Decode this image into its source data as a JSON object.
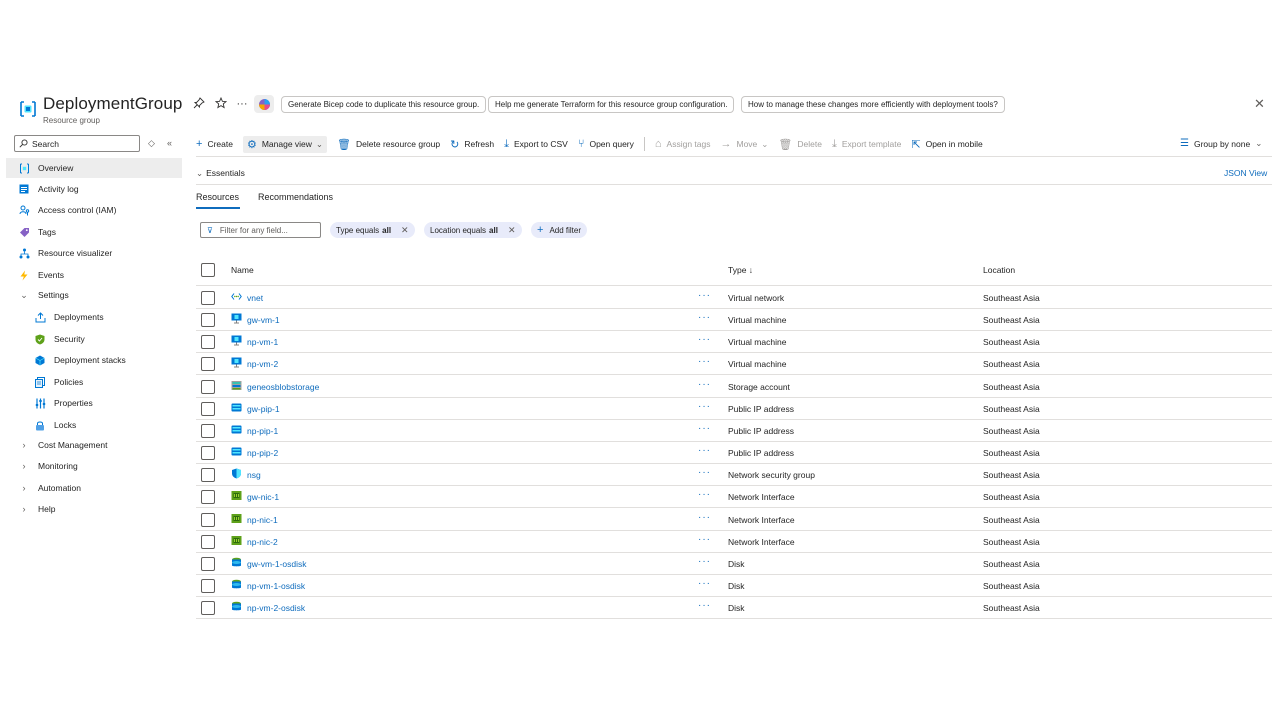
{
  "header": {
    "title": "DeploymentGroup",
    "subtitle": "Resource group",
    "suggestions": [
      "Generate Bicep code to duplicate this resource group.",
      "Help me generate Terraform for this resource group configuration.",
      "How to manage these changes more efficiently with deployment tools?"
    ],
    "close_glyph": "✕"
  },
  "sidebar": {
    "search_placeholder": "Search",
    "items": [
      {
        "label": "Overview",
        "icon": "resource-group-icon",
        "active": true
      },
      {
        "label": "Activity log",
        "icon": "activity-log-icon"
      },
      {
        "label": "Access control (IAM)",
        "icon": "iam-icon"
      },
      {
        "label": "Tags",
        "icon": "tag-icon"
      },
      {
        "label": "Resource visualizer",
        "icon": "visualizer-icon"
      },
      {
        "label": "Events",
        "icon": "lightning-icon"
      },
      {
        "label": "Settings",
        "icon": "chevron-down-icon",
        "expanded": true
      },
      {
        "label": "Deployments",
        "icon": "deployments-icon",
        "sub": true
      },
      {
        "label": "Security",
        "icon": "shield-icon",
        "sub": true
      },
      {
        "label": "Deployment stacks",
        "icon": "stack-icon",
        "sub": true
      },
      {
        "label": "Policies",
        "icon": "policy-icon",
        "sub": true
      },
      {
        "label": "Properties",
        "icon": "properties-icon",
        "sub": true
      },
      {
        "label": "Locks",
        "icon": "lock-icon",
        "sub": true
      },
      {
        "label": "Cost Management",
        "icon": "chevron-right-icon"
      },
      {
        "label": "Monitoring",
        "icon": "chevron-right-icon"
      },
      {
        "label": "Automation",
        "icon": "chevron-right-icon"
      },
      {
        "label": "Help",
        "icon": "chevron-right-icon"
      }
    ]
  },
  "toolbar": {
    "create": "Create",
    "manage_view": "Manage view",
    "delete_rg": "Delete resource group",
    "refresh": "Refresh",
    "export_csv": "Export to CSV",
    "open_query": "Open query",
    "assign_tags": "Assign tags",
    "move": "Move",
    "delete": "Delete",
    "export_template": "Export template",
    "open_mobile": "Open in mobile",
    "group_by": "Group by none"
  },
  "essentials": {
    "label": "Essentials",
    "json_view": "JSON View"
  },
  "tabs": [
    "Resources",
    "Recommendations"
  ],
  "filters": {
    "placeholder": "Filter for any field...",
    "type_prefix": "Type equals",
    "type_value": "all",
    "location_prefix": "Location equals",
    "location_value": "all",
    "add_filter": "Add filter"
  },
  "table": {
    "columns": {
      "name": "Name",
      "type": "Type ↓",
      "location": "Location"
    },
    "rows": [
      {
        "name": "vnet",
        "type": "Virtual network",
        "location": "Southeast Asia",
        "icon": "vnet"
      },
      {
        "name": "gw-vm-1",
        "type": "Virtual machine",
        "location": "Southeast Asia",
        "icon": "vm"
      },
      {
        "name": "np-vm-1",
        "type": "Virtual machine",
        "location": "Southeast Asia",
        "icon": "vm"
      },
      {
        "name": "np-vm-2",
        "type": "Virtual machine",
        "location": "Southeast Asia",
        "icon": "vm"
      },
      {
        "name": "geneosblobstorage",
        "type": "Storage account",
        "location": "Southeast Asia",
        "icon": "storage"
      },
      {
        "name": "gw-pip-1",
        "type": "Public IP address",
        "location": "Southeast Asia",
        "icon": "pip"
      },
      {
        "name": "np-pip-1",
        "type": "Public IP address",
        "location": "Southeast Asia",
        "icon": "pip"
      },
      {
        "name": "np-pip-2",
        "type": "Public IP address",
        "location": "Southeast Asia",
        "icon": "pip"
      },
      {
        "name": "nsg",
        "type": "Network security group",
        "location": "Southeast Asia",
        "icon": "nsg"
      },
      {
        "name": "gw-nic-1",
        "type": "Network Interface",
        "location": "Southeast Asia",
        "icon": "nic"
      },
      {
        "name": "np-nic-1",
        "type": "Network Interface",
        "location": "Southeast Asia",
        "icon": "nic"
      },
      {
        "name": "np-nic-2",
        "type": "Network Interface",
        "location": "Southeast Asia",
        "icon": "nic"
      },
      {
        "name": "gw-vm-1-osdisk",
        "type": "Disk",
        "location": "Southeast Asia",
        "icon": "disk"
      },
      {
        "name": "np-vm-1-osdisk",
        "type": "Disk",
        "location": "Southeast Asia",
        "icon": "disk"
      },
      {
        "name": "np-vm-2-osdisk",
        "type": "Disk",
        "location": "Southeast Asia",
        "icon": "disk"
      }
    ]
  },
  "colors": {
    "accent": "#0f6cbd",
    "chip_bg": "#e8ebfa",
    "active_bg": "#ededed"
  }
}
